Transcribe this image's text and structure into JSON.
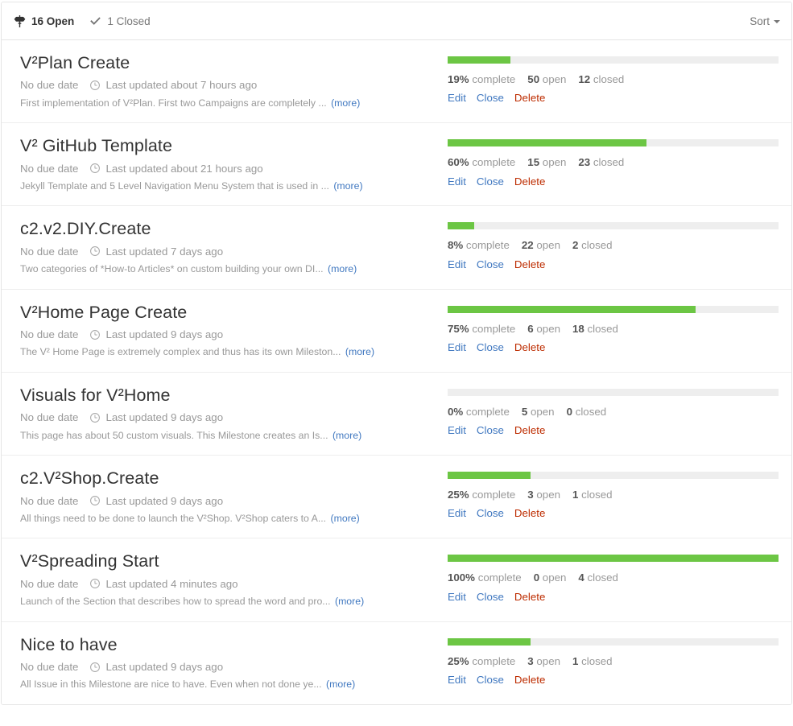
{
  "header": {
    "open": {
      "count": "16",
      "label": "Open",
      "icon": "milestone-icon"
    },
    "closed": {
      "count": "1",
      "label": "Closed",
      "icon": "check-icon"
    },
    "sort_label": "Sort"
  },
  "labels": {
    "complete": "complete",
    "open": "open",
    "closed": "closed",
    "edit": "Edit",
    "close": "Close",
    "delete": "Delete",
    "more": "(more)",
    "no_due_date": "No due date"
  },
  "colors": {
    "progress_fill": "#6cc644",
    "progress_track": "#eeeeee",
    "link": "#4078c0",
    "danger": "#bd2c00",
    "muted": "#999999"
  },
  "milestones": [
    {
      "title": "V²Plan Create",
      "due": "No due date",
      "updated": "Last updated about 7 hours ago",
      "description": "First implementation of V²Plan. First two Campaigns are completely ...",
      "more": "(more)",
      "percent": "19%",
      "percent_value": 19,
      "open": "50",
      "closed": "12"
    },
    {
      "title": "V² GitHub Template",
      "due": "No due date",
      "updated": "Last updated about 21 hours ago",
      "description": "Jekyll Template and 5 Level Navigation Menu System that is used in ...",
      "more": "(more)",
      "percent": "60%",
      "percent_value": 60,
      "open": "15",
      "closed": "23"
    },
    {
      "title": "c2.v2.DIY.Create",
      "due": "No due date",
      "updated": "Last updated 7 days ago",
      "description": "Two categories of *How-to Articles* on custom building your own DI...",
      "more": "(more)",
      "percent": "8%",
      "percent_value": 8,
      "open": "22",
      "closed": "2"
    },
    {
      "title": "V²Home Page Create",
      "due": "No due date",
      "updated": "Last updated 9 days ago",
      "description": "The V² Home Page is extremely complex and thus has its own Mileston...",
      "more": "(more)",
      "percent": "75%",
      "percent_value": 75,
      "open": "6",
      "closed": "18"
    },
    {
      "title": "Visuals for V²Home",
      "due": "No due date",
      "updated": "Last updated 9 days ago",
      "description": "This page has about 50 custom visuals. This Milestone creates an Is...",
      "more": "(more)",
      "percent": "0%",
      "percent_value": 0,
      "open": "5",
      "closed": "0"
    },
    {
      "title": "c2.V²Shop.Create",
      "due": "No due date",
      "updated": "Last updated 9 days ago",
      "description": "All things need to be done to launch the V²Shop. V²Shop caters to A...",
      "more": "(more)",
      "percent": "25%",
      "percent_value": 25,
      "open": "3",
      "closed": "1"
    },
    {
      "title": "V²Spreading Start",
      "due": "No due date",
      "updated": "Last updated 4 minutes ago",
      "description": "Launch of the Section that describes how to spread the word and pro...",
      "more": "(more)",
      "percent": "100%",
      "percent_value": 100,
      "open": "0",
      "closed": "4"
    },
    {
      "title": "Nice to have",
      "due": "No due date",
      "updated": "Last updated 9 days ago",
      "description": "All Issue in this Milestone are nice to have. Even when not done ye...",
      "more": "(more)",
      "percent": "25%",
      "percent_value": 25,
      "open": "3",
      "closed": "1"
    }
  ]
}
